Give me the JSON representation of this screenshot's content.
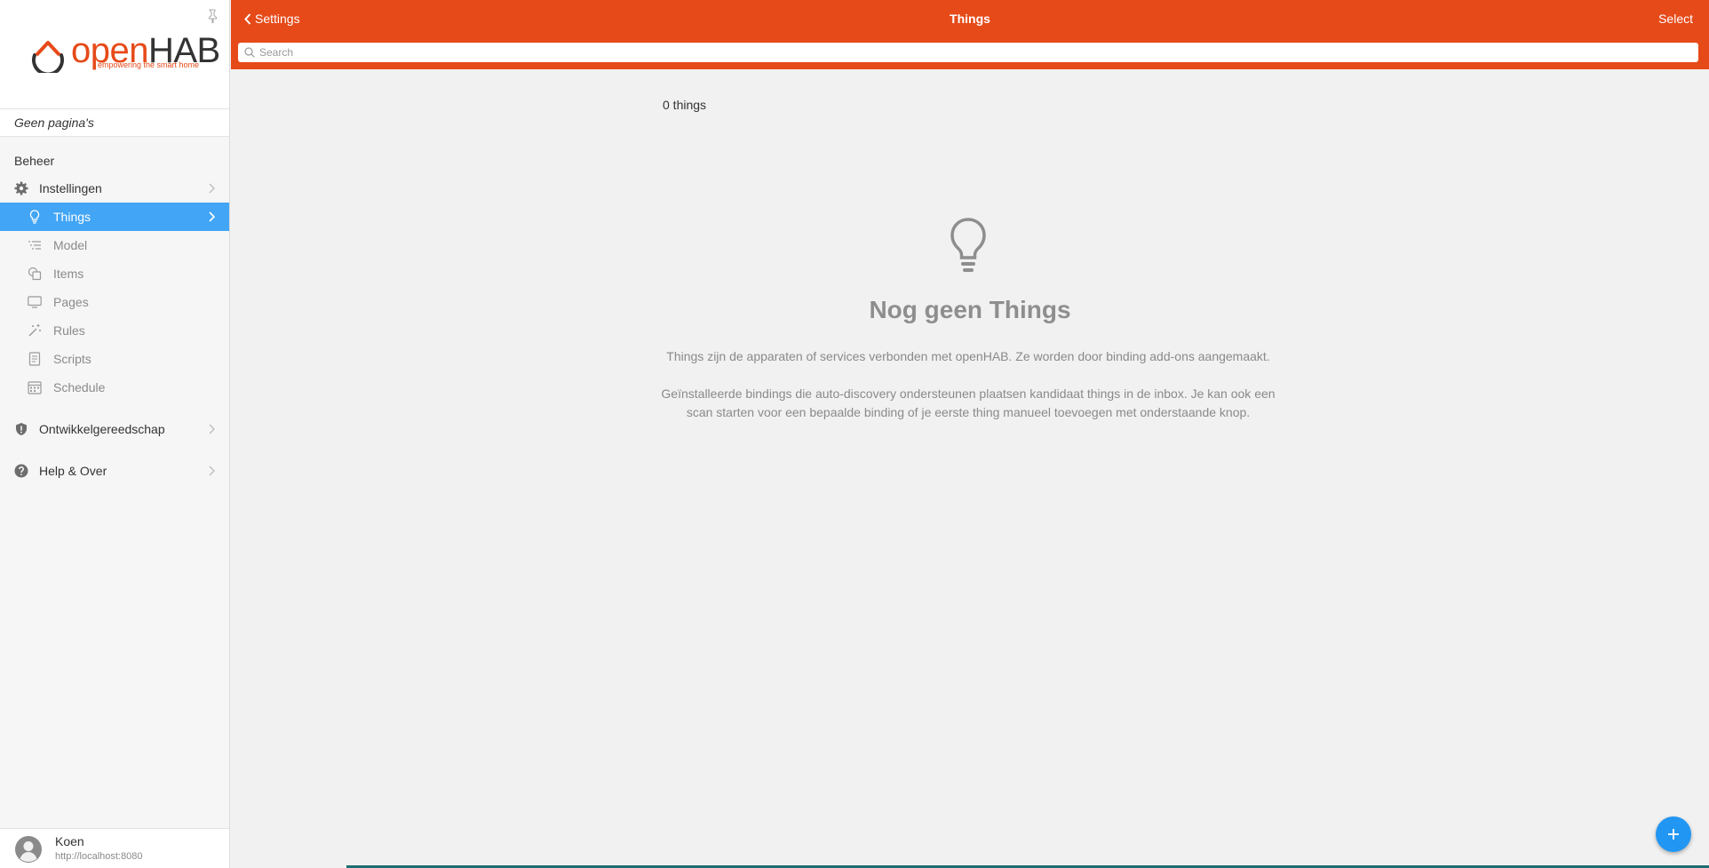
{
  "sidebar": {
    "logo": {
      "open": "open",
      "hab": "HAB",
      "tagline": "empowering the smart home"
    },
    "no_pages": "Geen pagina's",
    "section_title": "Beheer",
    "settings": {
      "label": "Instellingen"
    },
    "subitems": [
      {
        "label": "Things",
        "icon": "lightbulb-icon",
        "active": true
      },
      {
        "label": "Model",
        "icon": "list-icon"
      },
      {
        "label": "Items",
        "icon": "items-icon"
      },
      {
        "label": "Pages",
        "icon": "monitor-icon"
      },
      {
        "label": "Rules",
        "icon": "magic-wand-icon"
      },
      {
        "label": "Scripts",
        "icon": "document-icon"
      },
      {
        "label": "Schedule",
        "icon": "calendar-icon"
      }
    ],
    "developer_tools": {
      "label": "Ontwikkelgereedschap",
      "icon": "shield-icon"
    },
    "help": {
      "label": "Help & Over",
      "icon": "help-icon"
    },
    "user": {
      "name": "Koen",
      "url": "http://localhost:8080"
    }
  },
  "header": {
    "back_label": "Settings",
    "title": "Things",
    "select_label": "Select",
    "search_placeholder": "Search"
  },
  "main": {
    "count": "0 things",
    "empty_title": "Nog geen Things",
    "empty_text_1": "Things zijn de apparaten of services verbonden met openHAB. Ze worden door binding add-ons aangemaakt.",
    "empty_text_2": "Geïnstalleerde bindings die auto-discovery ondersteunen plaatsen kandidaat things in de inbox. Je kan ook een scan starten voor een bepaalde binding of je eerste thing manueel toevoegen met onderstaande knop."
  },
  "colors": {
    "header": "#e64a19",
    "active_item": "#42a5f5",
    "fab": "#2196f3"
  }
}
